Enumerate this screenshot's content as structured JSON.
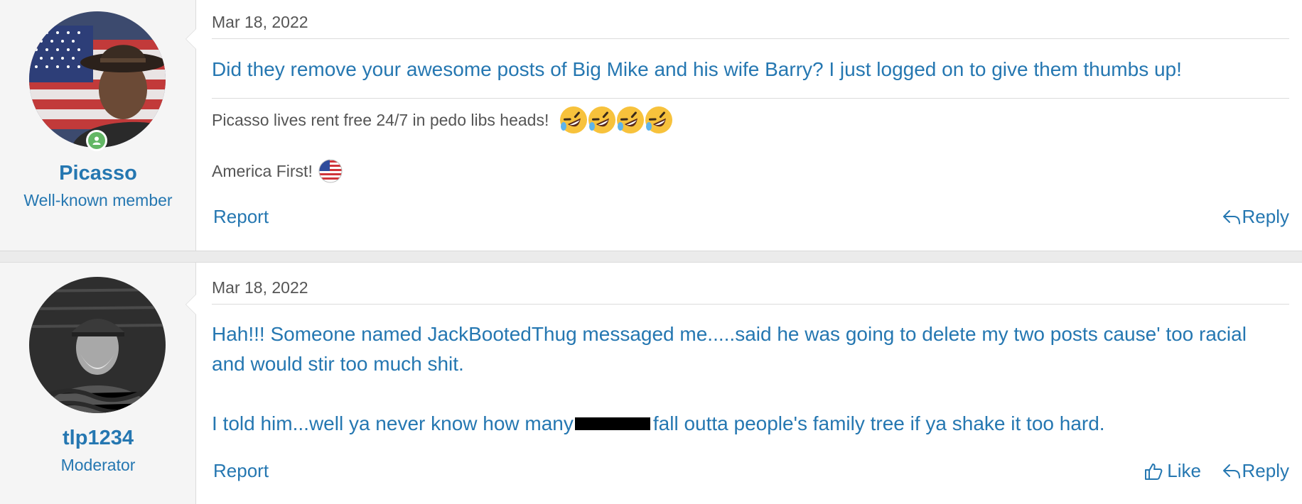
{
  "posts": [
    {
      "username": "Picasso",
      "user_title": "Well-known member",
      "online": true,
      "date": "Mar 18, 2022",
      "message": "Did they remove your awesome posts of Big Mike and his wife Barry? I just logged on to give them thumbs up!",
      "signature": {
        "line1": "Picasso lives rent free 24/7 in pedo libs heads!",
        "line1_emoji": [
          "rolling-on-floor-laughing",
          "rolling-on-floor-laughing",
          "rolling-on-floor-laughing",
          "rolling-on-floor-laughing"
        ],
        "line2": "America First!",
        "line2_emoji": "us-flag"
      },
      "actions": {
        "report": "Report",
        "reply": "Reply"
      }
    },
    {
      "username": "tlp1234",
      "user_title": "Moderator",
      "date": "Mar 18, 2022",
      "message_p1": "Hah!!! Someone named JackBootedThug messaged me.....said he was going to delete my two posts cause' too racial and would stir too much shit.",
      "message_p2_before": "I told him...well ya never know how many",
      "message_p2_after": "fall outta people's family tree if ya shake it too hard.",
      "actions": {
        "report": "Report",
        "like": "Like",
        "reply": "Reply"
      }
    }
  ],
  "colors": {
    "link": "#2577b1",
    "online": "#63b765",
    "sidebar": "#f5f5f5"
  }
}
